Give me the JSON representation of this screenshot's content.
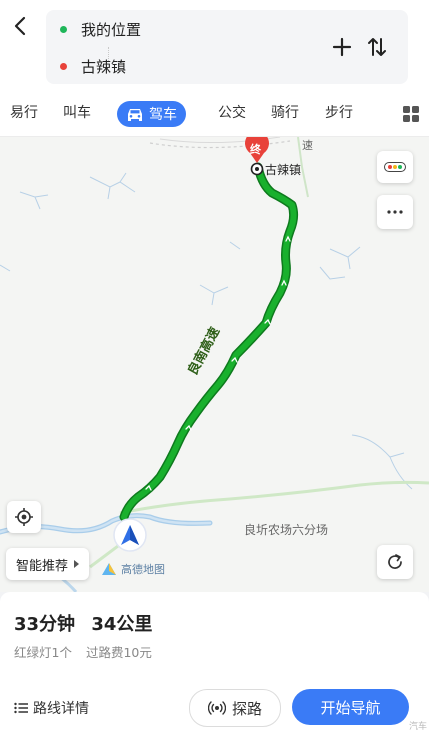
{
  "header": {
    "origin": "我的位置",
    "destination": "古辣镇",
    "colors": {
      "origin_dot": "#1fb65a",
      "destination_dot": "#e8423a"
    }
  },
  "tabs": [
    {
      "label": "易行",
      "active": false
    },
    {
      "label": "叫车",
      "active": false
    },
    {
      "label": "驾车",
      "active": true
    },
    {
      "label": "公交",
      "active": false
    },
    {
      "label": "骑行",
      "active": false
    },
    {
      "label": "步行",
      "active": false
    }
  ],
  "map": {
    "end_badge": "终",
    "destination_label": "古辣镇",
    "road_label": "良南高速",
    "place_label": "良圻农场六分场",
    "top_road_fragment": "速",
    "logo_text": "高德地图",
    "route_color": "#19b02d",
    "route_outline": "#0e7a1d"
  },
  "controls": {
    "smart_recommend": "智能推荐"
  },
  "summary": {
    "duration": "33分钟",
    "distance": "34公里",
    "traffic_lights": "红绿灯1个",
    "toll": "过路费10元"
  },
  "actions": {
    "route_details": "路线详情",
    "explore": "探路",
    "start_navigation": "开始导航"
  },
  "watermark": "汽车",
  "accent": "#3a7bf6"
}
